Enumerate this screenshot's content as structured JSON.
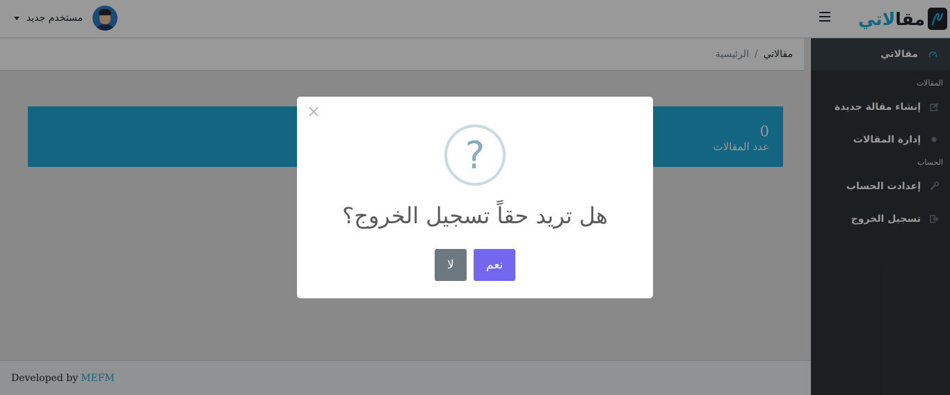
{
  "header": {
    "user_name": "مستخدم جديد",
    "logo": {
      "part_dark": "مقا",
      "part_blue": "لاتي"
    }
  },
  "sidebar": {
    "active_item": {
      "label": "مقالاتي",
      "icon": "speedometer-icon"
    },
    "sections": [
      {
        "title": "المقالات",
        "items": [
          {
            "label": "إنشاء مقالة جديدة",
            "icon": "edit-icon"
          },
          {
            "label": "إدارة المقالات",
            "icon": "gear-icon"
          }
        ]
      },
      {
        "title": "الحساب",
        "items": [
          {
            "label": "إعدادت الحساب",
            "icon": "wrench-icon"
          },
          {
            "label": "تسجيل الخروج",
            "icon": "sign-out-icon"
          }
        ]
      }
    ]
  },
  "breadcrumb": {
    "active": "مقالاتي",
    "home": "الرئيسية"
  },
  "stats_card": {
    "count": "0",
    "label": "عدد المقالات",
    "color": "#20a8d8"
  },
  "footer": {
    "text": "Developed by",
    "link": "MEFM"
  },
  "modal": {
    "icon": "question-icon",
    "icon_glyph": "?",
    "title": "هل تريد حقاً تسجيل الخروج؟",
    "yes_label": "نعم",
    "no_label": "لا",
    "yes_color": "#7367f0",
    "no_color": "#6e7881"
  }
}
